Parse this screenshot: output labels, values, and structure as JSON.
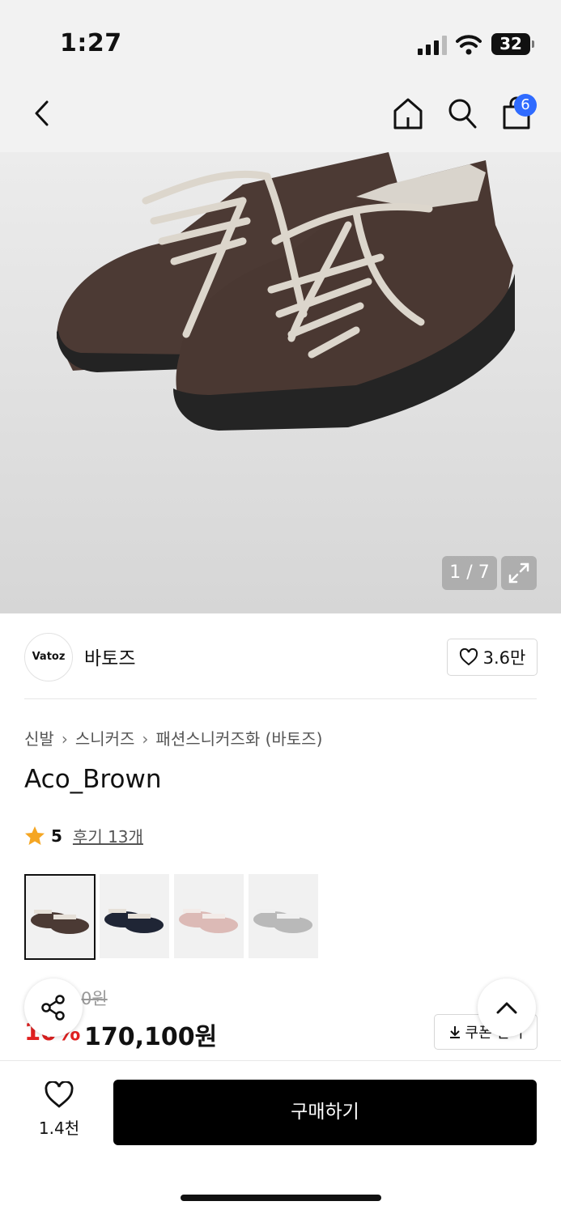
{
  "status_bar": {
    "time": "1:27",
    "battery": "32"
  },
  "header": {
    "cart_count": "6"
  },
  "gallery": {
    "counter": "1 / 7"
  },
  "brand": {
    "logo_text": "Vatoz",
    "name": "바토즈",
    "likes": "3.6만"
  },
  "breadcrumb": [
    "신발",
    "스니커즈",
    "패션스니커즈화 (바토즈)"
  ],
  "product": {
    "title": "Aco_Brown"
  },
  "rating": {
    "score": "5",
    "reviews_label": "후기 13개"
  },
  "variants": [
    {
      "name": "brown",
      "shoe": "#4b3a34",
      "sole": "#2a2a2a"
    },
    {
      "name": "navy",
      "shoe": "#1f2535",
      "sole": "#222"
    },
    {
      "name": "pink",
      "shoe": "#dcbab6",
      "sole": "#e8d8d5"
    },
    {
      "name": "gray",
      "shoe": "#b9b9b9",
      "sole": "#d8d8d8"
    }
  ],
  "pricing": {
    "original": "0원",
    "discount": "10%",
    "price": "170,100원",
    "coupon_label": "쿠폰 받기"
  },
  "bottom_bar": {
    "wish_count": "1.4천",
    "buy_label": "구매하기"
  },
  "colors": {
    "accent_blue": "#2f6bff",
    "sale_red": "#e02020",
    "star": "#f5a623"
  }
}
